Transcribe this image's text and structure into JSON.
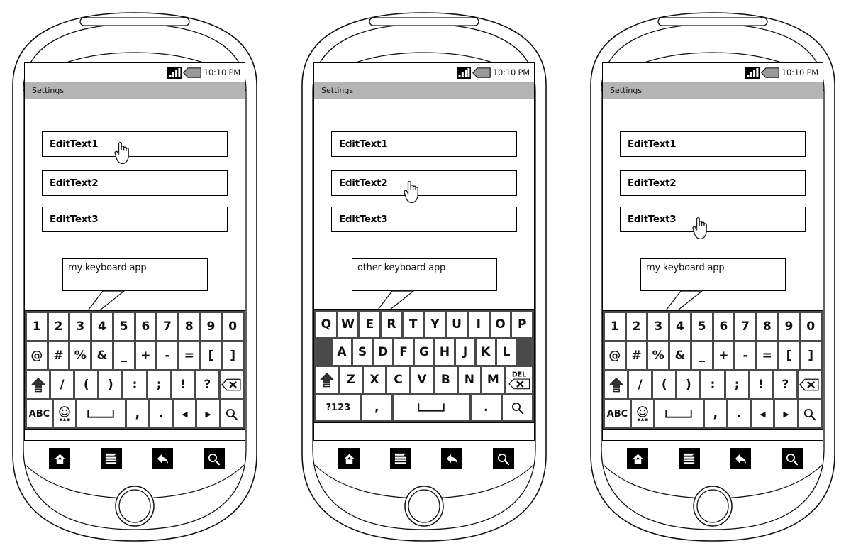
{
  "meta": {
    "title": "Android keyboard app wireframe - three phone mockups"
  },
  "status": {
    "time": "10:10 PM",
    "signal_icon": "signal-bars-icon",
    "battery_icon": "battery-icon"
  },
  "titlebar": {
    "label": "Settings"
  },
  "fields": {
    "items": [
      {
        "label": "EditText1"
      },
      {
        "label": "EditText2"
      },
      {
        "label": "EditText3"
      }
    ]
  },
  "nav": {
    "buttons": [
      {
        "name": "home-button",
        "icon": "home-icon"
      },
      {
        "name": "menu-button",
        "icon": "menu-icon"
      },
      {
        "name": "back-button",
        "icon": "back-arrow-icon"
      },
      {
        "name": "search-button",
        "icon": "search-icon"
      }
    ]
  },
  "phones": [
    {
      "id": "phone-1",
      "callout": "my keyboard app",
      "focused_field": "EditText1",
      "cursor_on": "EditText1",
      "keyboard": "symbols"
    },
    {
      "id": "phone-2",
      "callout": "other keyboard app",
      "focused_field": "EditText2",
      "cursor_on": "EditText2",
      "keyboard": "qwerty"
    },
    {
      "id": "phone-3",
      "callout": "my keyboard app",
      "focused_field": "EditText3",
      "cursor_on": "EditText3",
      "keyboard": "symbols"
    }
  ],
  "keyboards": {
    "symbols": {
      "name": "symbols-keyboard",
      "rows": [
        {
          "keys": [
            {
              "label": "1",
              "name": "key-1"
            },
            {
              "label": "2",
              "name": "key-2"
            },
            {
              "label": "3",
              "name": "key-3"
            },
            {
              "label": "4",
              "name": "key-4"
            },
            {
              "label": "5",
              "name": "key-5"
            },
            {
              "label": "6",
              "name": "key-6"
            },
            {
              "label": "7",
              "name": "key-7"
            },
            {
              "label": "8",
              "name": "key-8"
            },
            {
              "label": "9",
              "name": "key-9"
            },
            {
              "label": "0",
              "name": "key-0"
            }
          ]
        },
        {
          "keys": [
            {
              "label": "@",
              "name": "key-at"
            },
            {
              "label": "#",
              "name": "key-hash"
            },
            {
              "label": "%",
              "name": "key-percent"
            },
            {
              "label": "&",
              "name": "key-ampersand"
            },
            {
              "label": "_",
              "name": "key-underscore"
            },
            {
              "label": "+",
              "name": "key-plus"
            },
            {
              "label": "-",
              "name": "key-minus"
            },
            {
              "label": "=",
              "name": "key-equals"
            },
            {
              "label": "[",
              "name": "key-bracket-left"
            },
            {
              "label": "]",
              "name": "key-bracket-right"
            }
          ]
        },
        {
          "keys": [
            {
              "label": "",
              "name": "key-shift",
              "icon": "shift-icon"
            },
            {
              "label": "/",
              "name": "key-slash"
            },
            {
              "label": "(",
              "name": "key-paren-left"
            },
            {
              "label": ")",
              "name": "key-paren-right"
            },
            {
              "label": ":",
              "name": "key-colon"
            },
            {
              "label": ";",
              "name": "key-semicolon"
            },
            {
              "label": "!",
              "name": "key-exclamation"
            },
            {
              "label": "?",
              "name": "key-question"
            },
            {
              "label": "",
              "name": "key-backspace",
              "icon": "backspace-icon"
            }
          ]
        },
        {
          "keys": [
            {
              "label": "ABC",
              "name": "key-abc"
            },
            {
              "label": "",
              "name": "key-emoji",
              "icon": "smiley-icon"
            },
            {
              "label": "",
              "name": "key-space",
              "icon": "space-icon"
            },
            {
              "label": ",",
              "name": "key-comma"
            },
            {
              "label": ".",
              "name": "key-period"
            },
            {
              "label": "◀",
              "name": "key-arrow-left"
            },
            {
              "label": "▶",
              "name": "key-arrow-right"
            },
            {
              "label": "",
              "name": "key-search",
              "icon": "search-icon"
            }
          ]
        }
      ]
    },
    "qwerty": {
      "name": "qwerty-keyboard",
      "rows": [
        {
          "keys": [
            {
              "label": "Q",
              "name": "key-q"
            },
            {
              "label": "W",
              "name": "key-w"
            },
            {
              "label": "E",
              "name": "key-e"
            },
            {
              "label": "R",
              "name": "key-r"
            },
            {
              "label": "T",
              "name": "key-t"
            },
            {
              "label": "Y",
              "name": "key-y"
            },
            {
              "label": "U",
              "name": "key-u"
            },
            {
              "label": "I",
              "name": "key-i"
            },
            {
              "label": "O",
              "name": "key-o"
            },
            {
              "label": "P",
              "name": "key-p"
            }
          ]
        },
        {
          "indent": true,
          "keys": [
            {
              "label": "A",
              "name": "key-a"
            },
            {
              "label": "S",
              "name": "key-s"
            },
            {
              "label": "D",
              "name": "key-d"
            },
            {
              "label": "F",
              "name": "key-f"
            },
            {
              "label": "G",
              "name": "key-g"
            },
            {
              "label": "H",
              "name": "key-h"
            },
            {
              "label": "J",
              "name": "key-j"
            },
            {
              "label": "K",
              "name": "key-k"
            },
            {
              "label": "L",
              "name": "key-l"
            }
          ]
        },
        {
          "keys": [
            {
              "label": "",
              "name": "key-shift",
              "icon": "shift-icon"
            },
            {
              "label": "Z",
              "name": "key-z"
            },
            {
              "label": "X",
              "name": "key-x"
            },
            {
              "label": "C",
              "name": "key-c"
            },
            {
              "label": "V",
              "name": "key-v"
            },
            {
              "label": "B",
              "name": "key-b"
            },
            {
              "label": "N",
              "name": "key-n"
            },
            {
              "label": "M",
              "name": "key-m"
            },
            {
              "label": "DEL",
              "name": "key-delete",
              "icon": "delete-icon"
            }
          ]
        },
        {
          "keys": [
            {
              "label": "?123",
              "name": "key-symbols"
            },
            {
              "label": ",",
              "name": "key-comma"
            },
            {
              "label": "",
              "name": "key-space",
              "icon": "space-icon"
            },
            {
              "label": ".",
              "name": "key-period"
            },
            {
              "label": "",
              "name": "key-search",
              "icon": "search-icon"
            }
          ]
        }
      ]
    }
  },
  "colors": {
    "keyboard_bg": "#4a4a4a",
    "key_bg": "#ffffff",
    "titlebar_bg": "#b4b4b4",
    "nav_btn_bg": "#000000",
    "battery_fill": "#9a9a9a",
    "screen_bg": "#ffffff"
  }
}
